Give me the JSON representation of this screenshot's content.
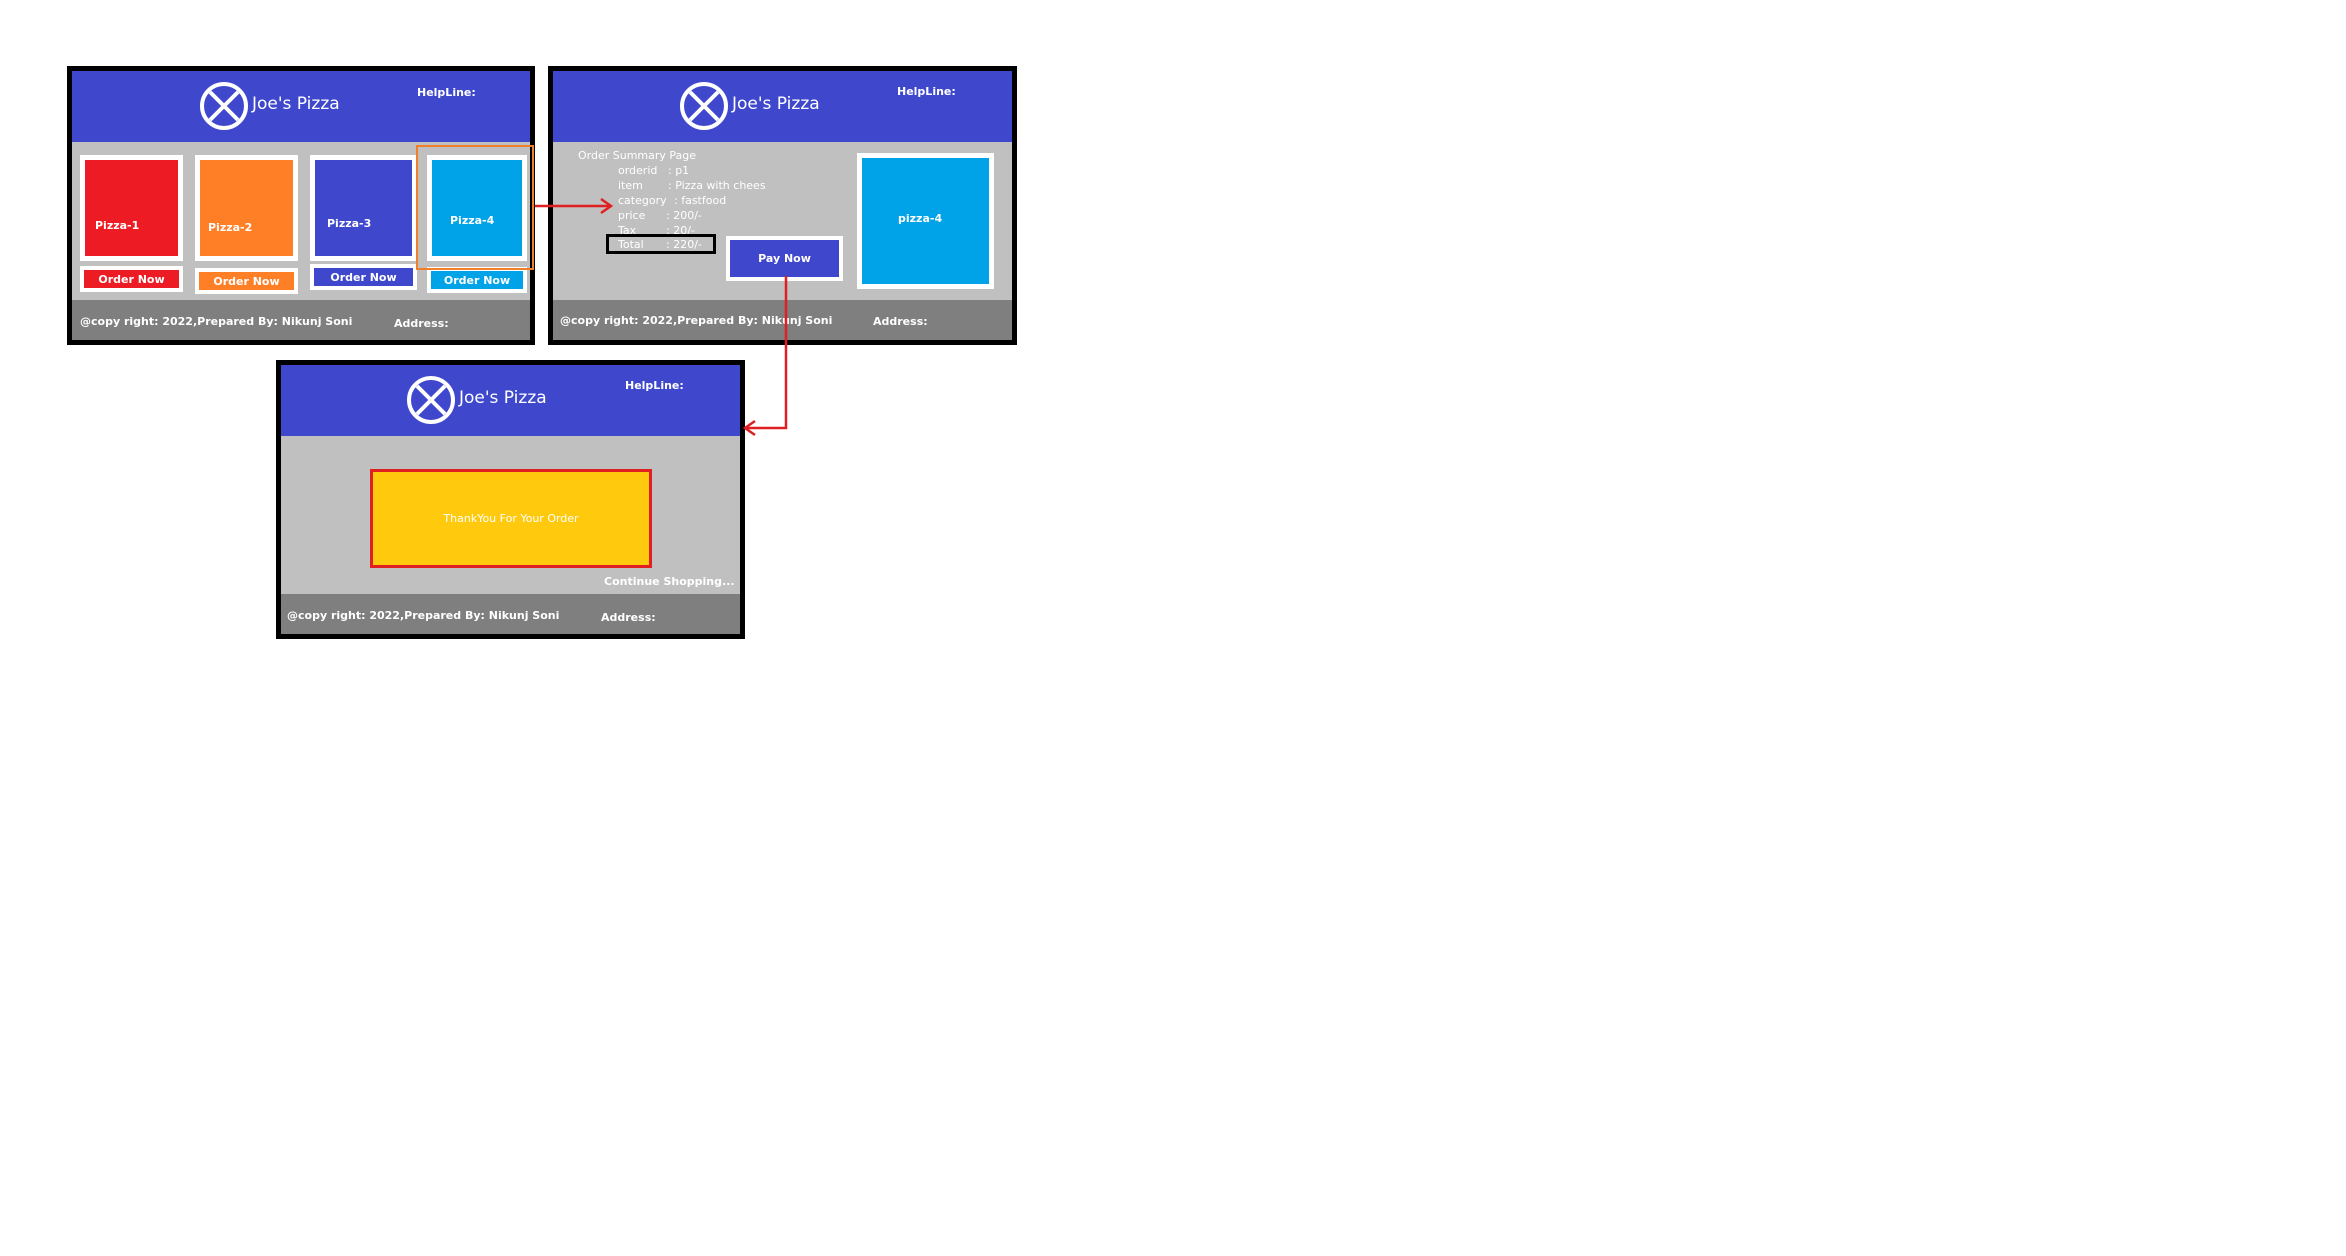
{
  "brand": {
    "name": "Joe's Pizza",
    "helpline": "HelpLine:"
  },
  "footer": {
    "copyright": "@copy right: 2022,Prepared By: Nikunj Soni",
    "address": "Address:"
  },
  "colors": {
    "header": "#3f48cc",
    "body": "#c0c0c0",
    "footer": "#7f7f7f",
    "highlight": "#f07f2c",
    "arrow": "#e02020",
    "thanks": "#ffc90e"
  },
  "menu_screen": {
    "pizzas": [
      {
        "label": "Pizza-1",
        "color": "#ed1c24",
        "button": "Order Now"
      },
      {
        "label": "Pizza-2",
        "color": "#ff7f27",
        "button": "Order Now"
      },
      {
        "label": "Pizza-3",
        "color": "#3f48cc",
        "button": "Order Now"
      },
      {
        "label": "Pizza-4",
        "color": "#00a2e8",
        "button": "Order Now"
      }
    ]
  },
  "summary_screen": {
    "title": "Order Summary Page",
    "rows": [
      {
        "key": "orderid",
        "value": ": p1"
      },
      {
        "key": "item",
        "value": ": Pizza with chees"
      },
      {
        "key": "category",
        "value": ": fastfood"
      },
      {
        "key": "price",
        "value": ": 200/-"
      },
      {
        "key": "Tax",
        "value": ": 20/-"
      },
      {
        "key": "Total",
        "value": ": 220/-"
      }
    ],
    "pay_button": "Pay Now",
    "product_label": "pizza-4"
  },
  "thanks_screen": {
    "message": "ThankYou For Your Order",
    "continue_link": "Continue Shopping..."
  }
}
